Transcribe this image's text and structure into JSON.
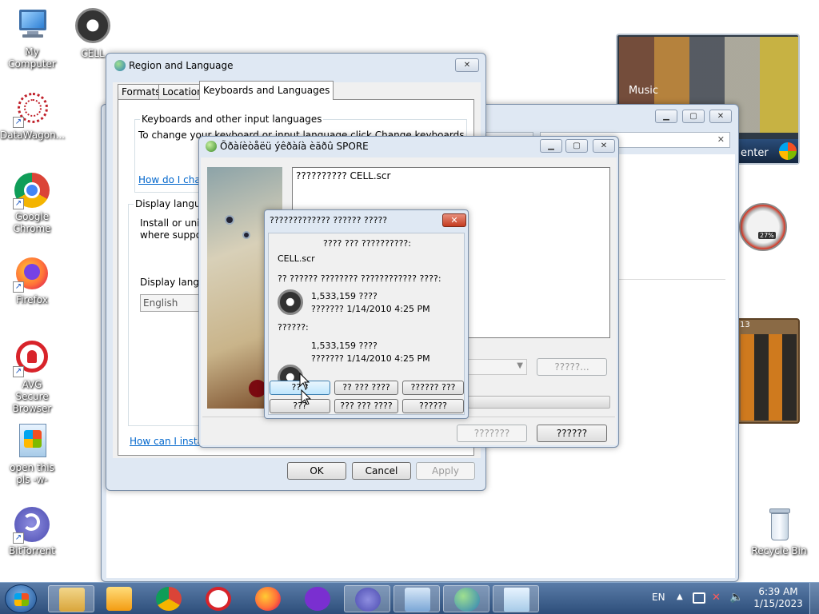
{
  "desktop": {
    "icons": [
      {
        "label": "My Computer"
      },
      {
        "label": "CELL"
      },
      {
        "label": "DataWagon..."
      },
      {
        "label": "Google Chrome"
      },
      {
        "label": "Firefox"
      },
      {
        "label": "AVG Secure Browser"
      },
      {
        "label": "open this pls -w-"
      },
      {
        "label": "BitTorrent"
      },
      {
        "label": "Recycle Bin"
      }
    ],
    "gadgets": {
      "media_center_label": "Music",
      "media_center_text": "enter",
      "cpu_percent": "27%",
      "puzzle_label": "13"
    }
  },
  "region_window": {
    "title": "Region and Language",
    "tabs": [
      "Formats",
      "Location",
      "Keyboards and Languages"
    ],
    "group1_title": "Keyboards and other input languages",
    "group1_text": "To change your keyboard or input language click Change keyboards.",
    "group1_link": "How do I chan",
    "group2_title": "Display languag",
    "group2_text1": "Install or unin",
    "group2_text2": "where suppor",
    "group2_label": "Display langua",
    "group2_select": "English",
    "bottom_link": "How can I install",
    "ok": "OK",
    "cancel": "Cancel",
    "apply": "Apply"
  },
  "spore_window": {
    "title": "Õðàíèòåëü ýêðàíà èãðû SPORE",
    "textbox": "?????????? CELL.scr",
    "right_button": "?????...",
    "btn1": "???????",
    "btn2": "??????"
  },
  "confirm_dialog": {
    "title": "????????????? ?????? ?????",
    "line1": "???? ??? ??????????:",
    "filename": "CELL.scr",
    "line2": "?? ?????? ???????? ???????????? ????:",
    "file1_size": "1,533,159 ????",
    "file1_date": "??????? 1/14/2010 4:25 PM",
    "line3": "??????:",
    "file2_size": "1,533,159 ????",
    "file2_date": "??????? 1/14/2010 4:25 PM",
    "buttons": [
      "?? ?",
      "?? ??? ????",
      "?????? ???",
      "???",
      "??? ??? ????",
      "??????"
    ]
  },
  "taskbar": {
    "lang": "EN",
    "time": "6:39 AM",
    "date": "1/15/2023"
  }
}
